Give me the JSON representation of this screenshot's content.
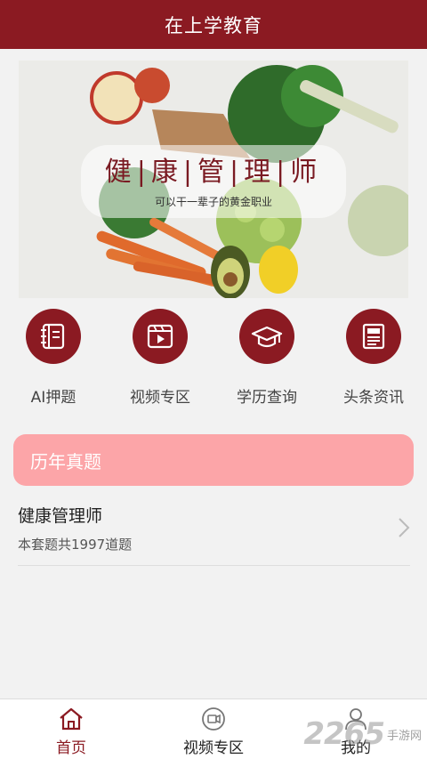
{
  "header": {
    "title": "在上学教育"
  },
  "banner": {
    "headline": "健|康|管|理|师",
    "subtitle": "可以干一辈子的黄金职业"
  },
  "quick_nav": [
    {
      "label": "AI押题",
      "icon": "book-icon"
    },
    {
      "label": "视频专区",
      "icon": "video-play-icon"
    },
    {
      "label": "学历查询",
      "icon": "graduation-cap-icon"
    },
    {
      "label": "头条资讯",
      "icon": "newspaper-icon"
    }
  ],
  "section": {
    "title": "历年真题"
  },
  "exam_list": [
    {
      "name": "健康管理师",
      "meta": "本套题共1997道题"
    }
  ],
  "tabbar": [
    {
      "label": "首页",
      "icon": "home-icon",
      "active": true
    },
    {
      "label": "视频专区",
      "icon": "video-camera-icon",
      "active": false
    },
    {
      "label": "我的",
      "icon": "user-icon",
      "active": false
    }
  ],
  "watermark": {
    "number": "2265",
    "text": "手游网"
  },
  "colors": {
    "primary": "#8b1a22",
    "section_bar": "#fca5a8",
    "background": "#f2f2f2"
  }
}
